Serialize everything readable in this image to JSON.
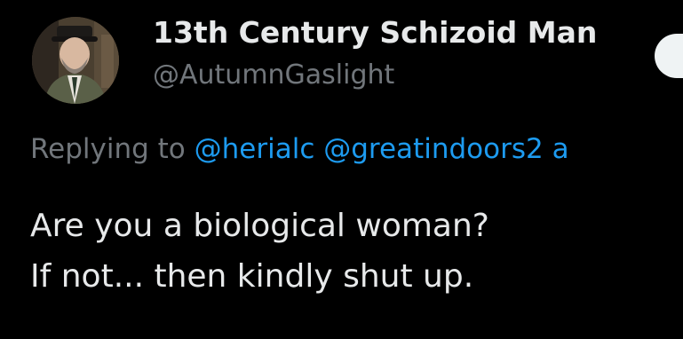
{
  "author": {
    "display_name": "13th Century Schizoid Man",
    "handle": "@AutumnGaslight",
    "avatar_icon": "profile-photo"
  },
  "reply": {
    "prefix": "Replying to",
    "mentions": [
      "@herialc",
      "@greatindoors2",
      "a"
    ]
  },
  "tweet": {
    "lines": [
      "Are you a biological woman?",
      "If not... then kindly shut up."
    ]
  },
  "colors": {
    "background": "#000000",
    "text": "#e7e9ea",
    "secondary": "#71767b",
    "link": "#1d9bf0",
    "button": "#eff3f4"
  }
}
